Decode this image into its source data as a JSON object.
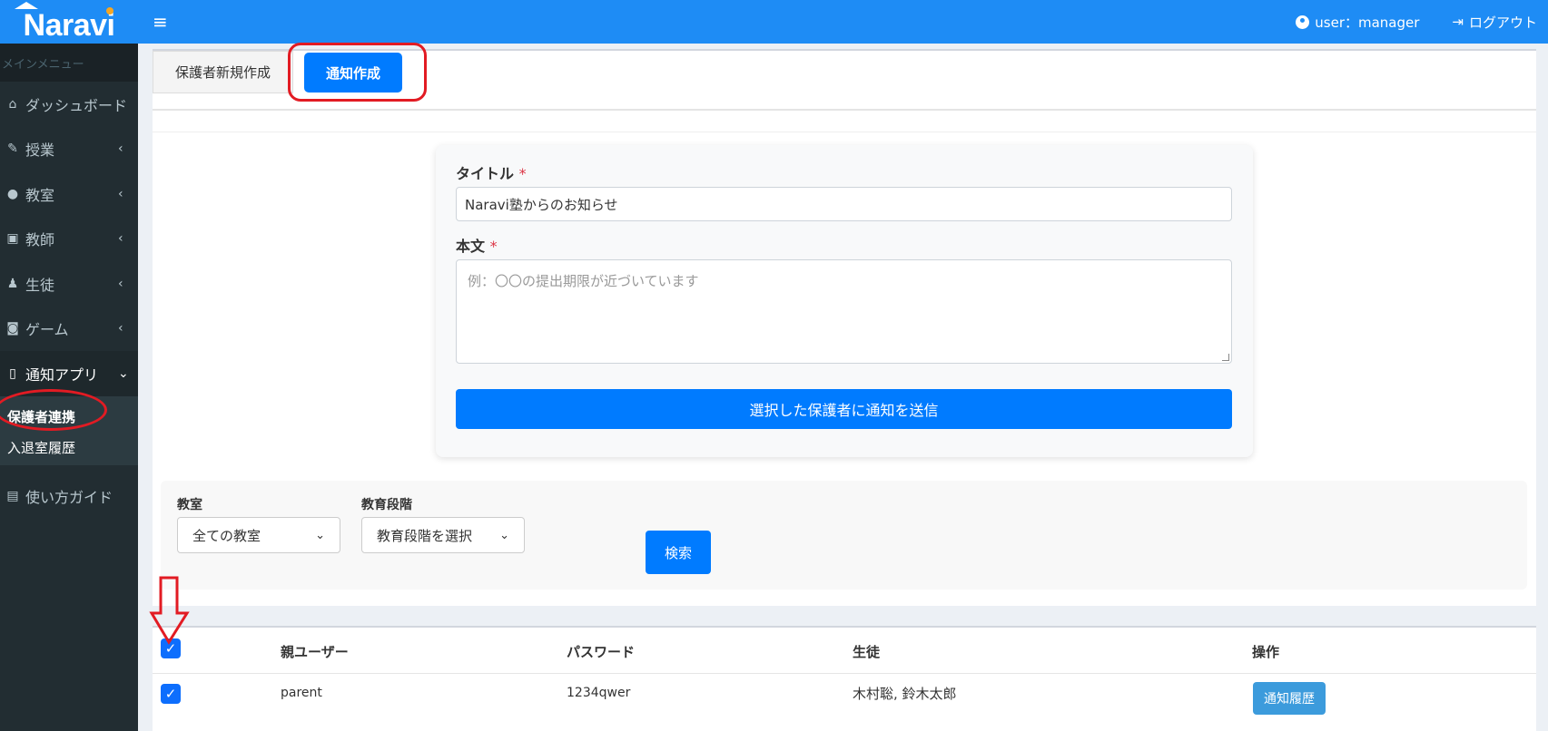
{
  "logo": {
    "text": "Naravi"
  },
  "topbar": {
    "menu_icon": "hamburger-icon",
    "user_label": "user：manager",
    "logout_label": "ログアウト"
  },
  "sidebar": {
    "header": "メインメニュー",
    "items": [
      {
        "label": "ダッシュボード",
        "icon": "home-icon"
      },
      {
        "label": "授業",
        "icon": "edit-icon"
      },
      {
        "label": "教室",
        "icon": "users-icon"
      },
      {
        "label": "教師",
        "icon": "id-card-icon"
      },
      {
        "label": "生徒",
        "icon": "child-icon"
      },
      {
        "label": "ゲーム",
        "icon": "gamepad-icon"
      },
      {
        "label": "通知アプリ",
        "icon": "mobile-icon"
      }
    ],
    "sub_items": [
      {
        "label": "保護者連携"
      },
      {
        "label": "入退室履歴"
      }
    ],
    "guide": {
      "label": "使い方ガイド",
      "icon": "book-icon"
    }
  },
  "tabs": [
    {
      "label": "保護者新規作成"
    },
    {
      "label": "通知作成"
    }
  ],
  "form": {
    "title_label": "タイトル",
    "required_mark": "*",
    "title_value": "Naravi塾からのお知らせ",
    "body_label": "本文",
    "body_placeholder": "例：〇〇の提出期限が近づいています",
    "send_button": "選択した保護者に通知を送信"
  },
  "filters": {
    "classroom_label": "教室",
    "classroom_value": "全ての教室",
    "stage_label": "教育段階",
    "stage_value": "教育段階を選択",
    "search_button": "検索"
  },
  "table": {
    "headers": {
      "user": "親ユーザー",
      "password": "パスワード",
      "student": "生徒",
      "action": "操作"
    },
    "rows": [
      {
        "user": "parent",
        "password": "1234qwer",
        "student": "木村聡, 鈴木太郎",
        "action": "通知履歴"
      }
    ]
  },
  "colors": {
    "topbar": "#1e8cf5",
    "sidebar": "#222d32",
    "primary": "#007bff",
    "annotation": "#e21b23"
  }
}
